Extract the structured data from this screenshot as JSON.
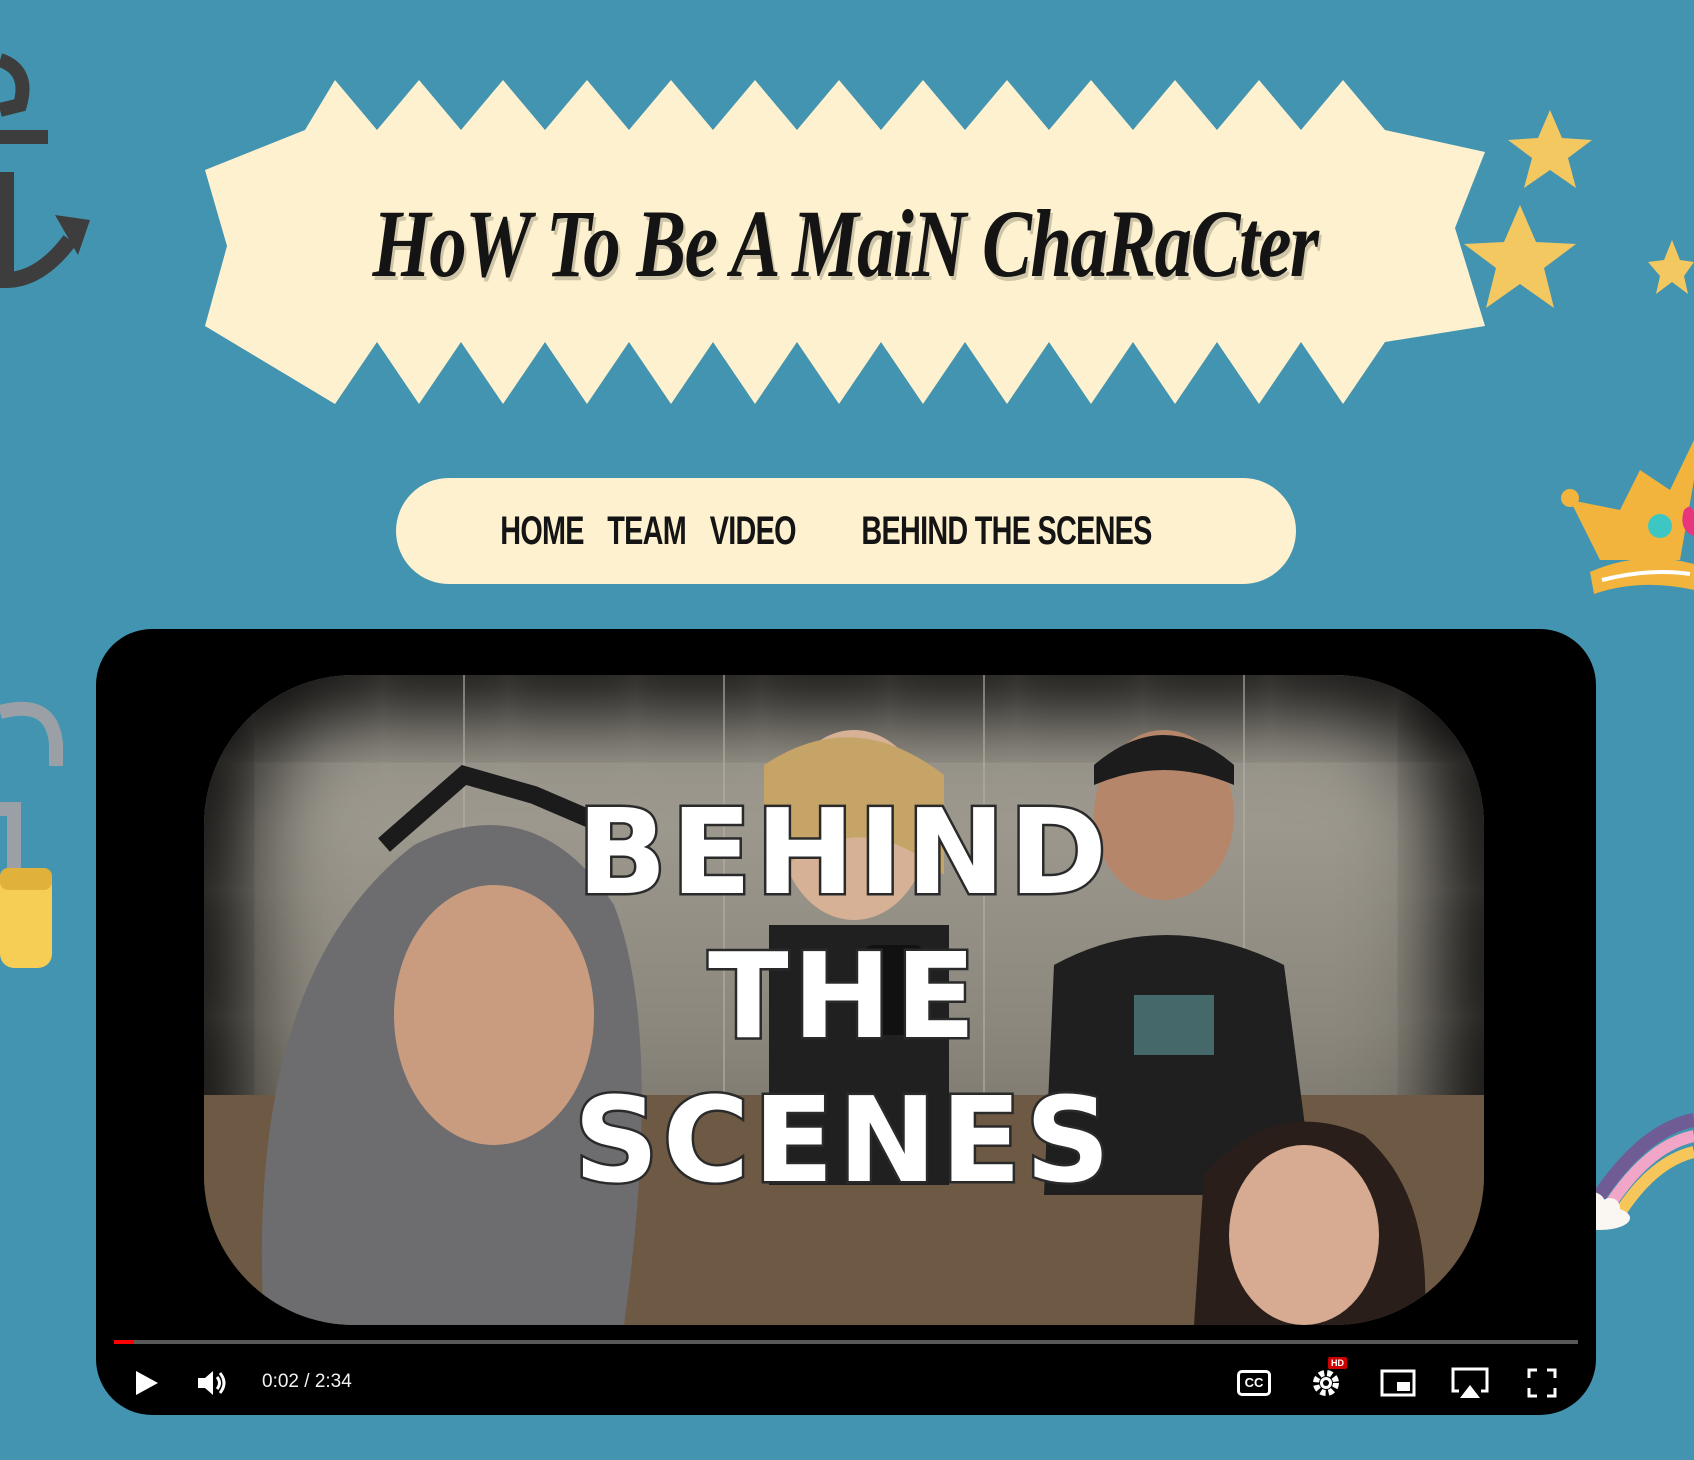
{
  "site": {
    "title": "HoW To Be A MaiN ChaRaCter"
  },
  "nav": {
    "items": [
      {
        "label": "HOME"
      },
      {
        "label": "TEAM"
      },
      {
        "label": "VIDEO"
      },
      {
        "label": "BEHIND THE SCENES"
      }
    ]
  },
  "video": {
    "overlay_lines": [
      "BEHIND",
      "THE",
      "SCENES"
    ],
    "current_time": "0:02",
    "duration": "2:34",
    "time_display": "0:02 / 2:34",
    "progress_fraction": 0.013,
    "quality_badge": "HD",
    "captions_label": "CC"
  },
  "colors": {
    "background": "#4394b0",
    "banner": "#fdf1cf",
    "star": "#f4c860",
    "progress": "#ff0000"
  },
  "icons": {
    "left_top": "anchor-icon",
    "left_middle": "padlock-icon",
    "right_top": "stars-icon",
    "right_middle": "crown-icon",
    "right_bottom": "rainbow-icon",
    "play": "play-icon",
    "volume": "volume-icon",
    "settings": "settings-gear-icon",
    "miniplayer": "miniplayer-icon",
    "airplay": "airplay-icon",
    "fullscreen": "fullscreen-icon"
  }
}
